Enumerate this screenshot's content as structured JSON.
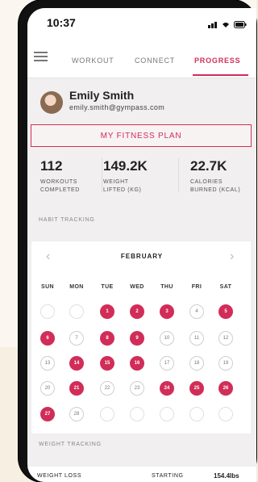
{
  "status": {
    "time": "10:37"
  },
  "nav": {
    "tabs": [
      {
        "label": "WORKOUT"
      },
      {
        "label": "CONNECT"
      },
      {
        "label": "PROGRESS",
        "active": true
      }
    ]
  },
  "profile": {
    "name": "Emily Smith",
    "email": "emily.smith@gympass.com"
  },
  "plan_button": {
    "label": "MY FITNESS PLAN"
  },
  "stats": [
    {
      "value": "112",
      "label_line1": "WORKOUTS",
      "label_line2": "COMPLETED"
    },
    {
      "value": "149.2K",
      "label_line1": "WEIGHT",
      "label_line2": "LIFTED (KG)"
    },
    {
      "value": "22.7K",
      "label_line1": "CALORIES",
      "label_line2": "BURNED (KCAL)"
    }
  ],
  "habit": {
    "section_label": "HABIT TRACKING",
    "month": "FEBRUARY",
    "weekdays": [
      "SUN",
      "MON",
      "TUE",
      "WED",
      "THU",
      "FRI",
      "SAT"
    ],
    "weeks": [
      [
        {
          "state": "blank"
        },
        {
          "state": "blank"
        },
        {
          "day": "1",
          "state": "active"
        },
        {
          "day": "2",
          "state": "active"
        },
        {
          "day": "3",
          "state": "active"
        },
        {
          "day": "4",
          "state": "inactive"
        },
        {
          "day": "5",
          "state": "active"
        }
      ],
      [
        {
          "day": "6",
          "state": "active"
        },
        {
          "day": "7",
          "state": "inactive"
        },
        {
          "day": "8",
          "state": "active"
        },
        {
          "day": "9",
          "state": "active"
        },
        {
          "day": "10",
          "state": "inactive"
        },
        {
          "day": "11",
          "state": "inactive"
        },
        {
          "day": "12",
          "state": "inactive"
        }
      ],
      [
        {
          "day": "13",
          "state": "inactive"
        },
        {
          "day": "14",
          "state": "active"
        },
        {
          "day": "15",
          "state": "active"
        },
        {
          "day": "16",
          "state": "active"
        },
        {
          "day": "17",
          "state": "inactive"
        },
        {
          "day": "18",
          "state": "inactive"
        },
        {
          "day": "19",
          "state": "inactive"
        }
      ],
      [
        {
          "day": "20",
          "state": "inactive"
        },
        {
          "day": "21",
          "state": "active"
        },
        {
          "day": "22",
          "state": "inactive"
        },
        {
          "day": "23",
          "state": "inactive"
        },
        {
          "day": "24",
          "state": "active"
        },
        {
          "day": "25",
          "state": "active"
        },
        {
          "day": "26",
          "state": "active"
        }
      ],
      [
        {
          "day": "27",
          "state": "active"
        },
        {
          "day": "28",
          "state": "inactive"
        },
        {
          "state": "blank"
        },
        {
          "state": "blank"
        },
        {
          "state": "blank"
        },
        {
          "state": "blank"
        },
        {
          "state": "blank"
        }
      ]
    ]
  },
  "weight": {
    "section_label": "WEIGHT TRACKING",
    "row_label": "WEIGHT LOSS",
    "starting_label": "STARTING",
    "starting_value": "154.4lbs"
  },
  "colors": {
    "accent": "#d12d58",
    "background": "#f1efef"
  },
  "icons": {
    "menu": "hamburger-icon",
    "prev": "chevron-left-icon",
    "next": "chevron-right-icon",
    "signal": "signal-icon",
    "wifi": "wifi-icon",
    "battery": "battery-icon"
  }
}
